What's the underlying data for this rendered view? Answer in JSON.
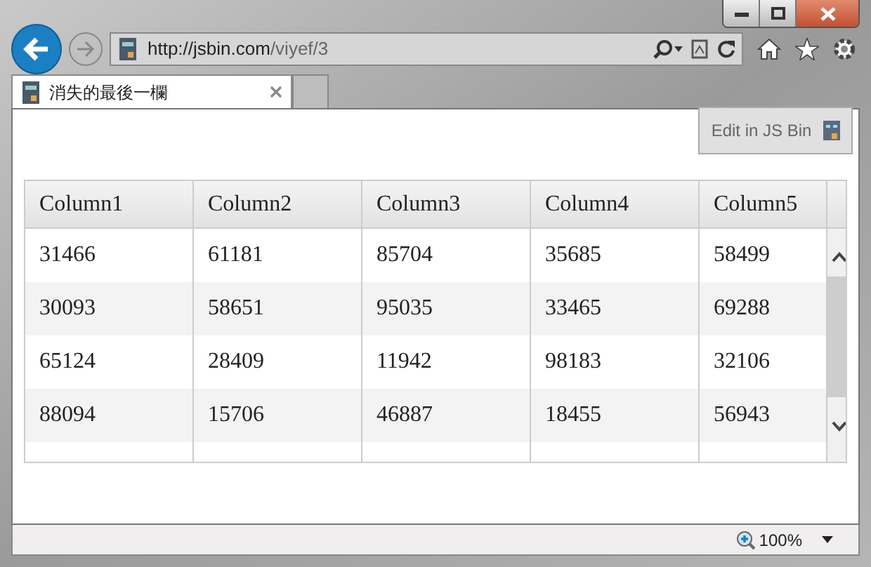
{
  "browser": {
    "address_host": "http://jsbin.com",
    "address_path": "/viyef/3",
    "tabs": [
      {
        "title": "消失的最後一欄",
        "selected": true
      },
      {
        "selected": false
      }
    ]
  },
  "page": {
    "edit_button": "Edit in JS Bin",
    "table": {
      "columns": [
        "Column1",
        "Column2",
        "Column3",
        "Column4",
        "Column5"
      ],
      "rows": [
        [
          "31466",
          "61181",
          "85704",
          "35685",
          "58499"
        ],
        [
          "30093",
          "58651",
          "95035",
          "33465",
          "69288"
        ],
        [
          "65124",
          "28409",
          "11942",
          "98183",
          "32106"
        ],
        [
          "88094",
          "15706",
          "46887",
          "18455",
          "56943"
        ]
      ]
    }
  },
  "status_bar": {
    "zoom": "100%"
  }
}
